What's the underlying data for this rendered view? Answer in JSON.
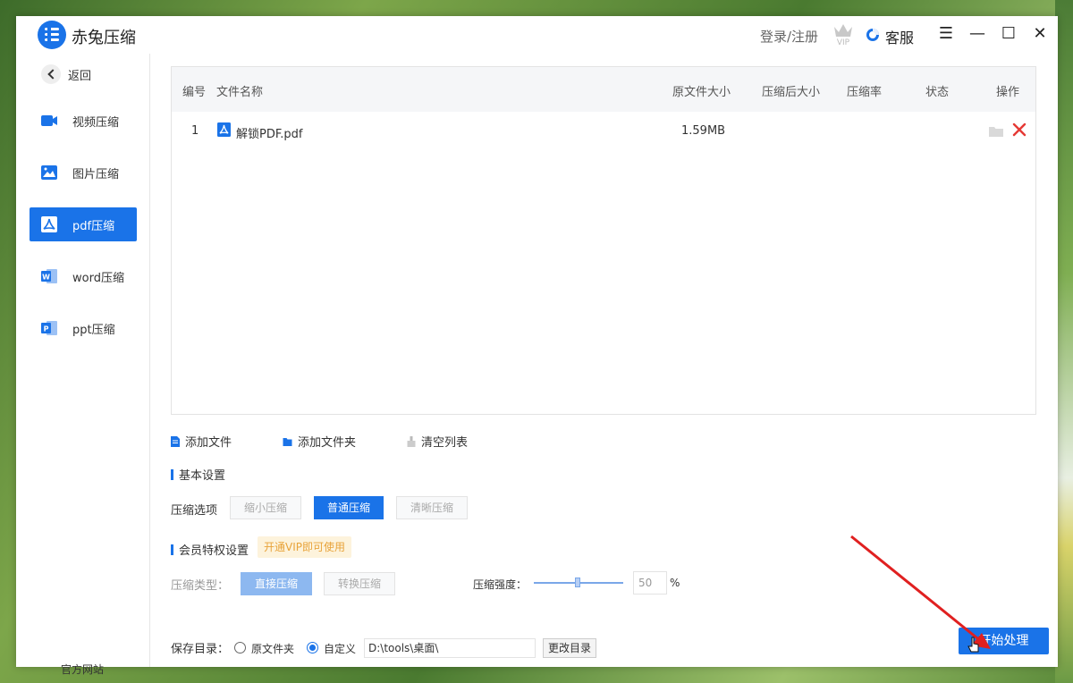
{
  "app": {
    "title": "赤兔压缩",
    "login": "登录/注册",
    "vip": "VIP",
    "service": "客服"
  },
  "sidebar": {
    "back": "返回",
    "items": [
      {
        "label": "视频压缩",
        "icon": "video-icon"
      },
      {
        "label": "图片压缩",
        "icon": "image-icon"
      },
      {
        "label": "pdf压缩",
        "icon": "pdf-icon",
        "active": true
      },
      {
        "label": "word压缩",
        "icon": "word-icon"
      },
      {
        "label": "ppt压缩",
        "icon": "ppt-icon"
      }
    ],
    "official": "官方网站"
  },
  "table": {
    "headers": [
      "编号",
      "文件名称",
      "原文件大小",
      "压缩后大小",
      "压缩率",
      "状态",
      "操作"
    ],
    "rows": [
      {
        "num": "1",
        "name": "解锁PDF.pdf",
        "orig_size": "1.59MB",
        "comp_size": "",
        "ratio": "",
        "status": ""
      }
    ]
  },
  "tools": {
    "add_file": "添加文件",
    "add_folder": "添加文件夹",
    "clear": "清空列表"
  },
  "basic": {
    "title": "基本设置",
    "option_label": "压缩选项",
    "options": [
      "缩小压缩",
      "普通压缩",
      "清晰压缩"
    ],
    "selected": "普通压缩"
  },
  "vip_settings": {
    "title": "会员特权设置",
    "tag": "开通VIP即可使用",
    "type_label": "压缩类型：",
    "types": [
      "直接压缩",
      "转换压缩"
    ],
    "strength_label": "压缩强度：",
    "strength_value": "50",
    "unit": "%"
  },
  "save": {
    "label": "保存目录：",
    "opt_original": "原文件夹",
    "opt_custom": "自定义",
    "path": "D:\\tools\\桌面\\",
    "change": "更改目录"
  },
  "start": "开始处理",
  "colors": {
    "accent": "#1a73e8",
    "danger": "#e53935",
    "vip_tag": "#e8a33a"
  }
}
